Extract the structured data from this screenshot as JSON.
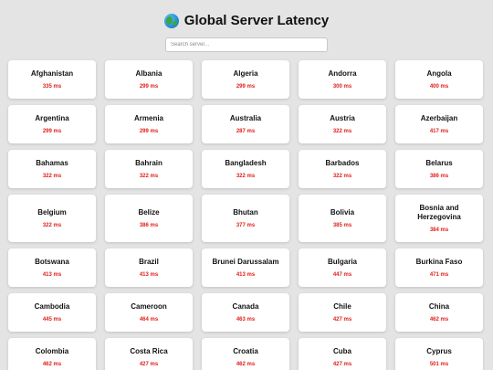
{
  "header": {
    "title": "Global Server Latency",
    "icon": "globe-icon"
  },
  "search": {
    "placeholder": "Search server..."
  },
  "colors": {
    "latency": "#e0201c",
    "background": "#e4e4e4"
  },
  "servers": [
    {
      "name": "Afghanistan",
      "latency": "335 ms"
    },
    {
      "name": "Albania",
      "latency": "299 ms"
    },
    {
      "name": "Algeria",
      "latency": "299 ms"
    },
    {
      "name": "Andorra",
      "latency": "300 ms"
    },
    {
      "name": "Angola",
      "latency": "400 ms"
    },
    {
      "name": "Argentina",
      "latency": "299 ms"
    },
    {
      "name": "Armenia",
      "latency": "299 ms"
    },
    {
      "name": "Australia",
      "latency": "287 ms"
    },
    {
      "name": "Austria",
      "latency": "322 ms"
    },
    {
      "name": "Azerbaijan",
      "latency": "417 ms"
    },
    {
      "name": "Bahamas",
      "latency": "322 ms"
    },
    {
      "name": "Bahrain",
      "latency": "322 ms"
    },
    {
      "name": "Bangladesh",
      "latency": "322 ms"
    },
    {
      "name": "Barbados",
      "latency": "322 ms"
    },
    {
      "name": "Belarus",
      "latency": "386 ms"
    },
    {
      "name": "Belgium",
      "latency": "322 ms"
    },
    {
      "name": "Belize",
      "latency": "386 ms"
    },
    {
      "name": "Bhutan",
      "latency": "377 ms"
    },
    {
      "name": "Bolivia",
      "latency": "385 ms"
    },
    {
      "name": "Bosnia and Herzegovina",
      "latency": "384 ms"
    },
    {
      "name": "Botswana",
      "latency": "413 ms"
    },
    {
      "name": "Brazil",
      "latency": "413 ms"
    },
    {
      "name": "Brunei Darussalam",
      "latency": "413 ms"
    },
    {
      "name": "Bulgaria",
      "latency": "447 ms"
    },
    {
      "name": "Burkina Faso",
      "latency": "471 ms"
    },
    {
      "name": "Cambodia",
      "latency": "445 ms"
    },
    {
      "name": "Cameroon",
      "latency": "464 ms"
    },
    {
      "name": "Canada",
      "latency": "463 ms"
    },
    {
      "name": "Chile",
      "latency": "427 ms"
    },
    {
      "name": "China",
      "latency": "462 ms"
    },
    {
      "name": "Colombia",
      "latency": "462 ms"
    },
    {
      "name": "Costa Rica",
      "latency": "427 ms"
    },
    {
      "name": "Croatia",
      "latency": "462 ms"
    },
    {
      "name": "Cuba",
      "latency": "427 ms"
    },
    {
      "name": "Cyprus",
      "latency": "501 ms"
    }
  ]
}
